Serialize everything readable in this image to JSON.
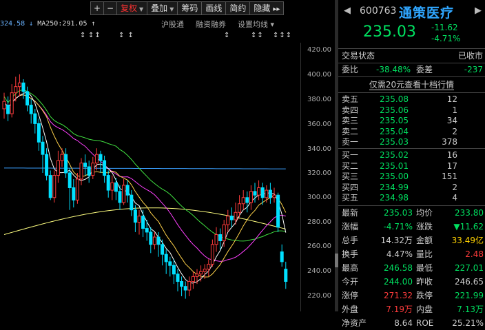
{
  "toolbar": {
    "items": [
      {
        "label": "+",
        "active": false,
        "caret": false
      },
      {
        "label": "−",
        "active": false,
        "caret": false
      },
      {
        "label": "复权",
        "active": true,
        "caret": true
      },
      {
        "label": "叠加",
        "active": false,
        "caret": true
      },
      {
        "label": "筹码",
        "active": false,
        "caret": false
      },
      {
        "label": "画线",
        "active": false,
        "caret": false
      },
      {
        "label": "简约",
        "active": false,
        "caret": false
      },
      {
        "label": "隐藏",
        "active": false,
        "caret": false
      }
    ],
    "more_icon": "double-chevron-right-icon"
  },
  "ma_bar": {
    "ma_prev_value": "324.58",
    "arrow1": "↓",
    "ma250_label": "MA250:",
    "ma250_value": "291.05",
    "arrow2": "↑"
  },
  "subtabs": [
    "沪股通",
    "融资融券",
    "设置均线 ▾"
  ],
  "stars": [
    "↕",
    "↕↕",
    "↕ ↕",
    "↕",
    "↕↕",
    "↕↕↕"
  ],
  "price_axis": [
    "420.00",
    "400.00",
    "380.00",
    "360.00",
    "340.00",
    "320.00",
    "300.00",
    "280.00",
    "260.00",
    "240.00",
    "220.00"
  ],
  "chart_data": {
    "type": "candlestick",
    "y_axis": [
      220,
      420
    ],
    "candles": [
      [
        372,
        378,
        364,
        385
      ],
      [
        375,
        368,
        362,
        382
      ],
      [
        368,
        385,
        365,
        392
      ],
      [
        385,
        390,
        378,
        398
      ],
      [
        390,
        393,
        382,
        400
      ],
      [
        393,
        386,
        380,
        396
      ],
      [
        386,
        375,
        370,
        390
      ],
      [
        375,
        368,
        360,
        380
      ],
      [
        368,
        360,
        352,
        372
      ],
      [
        360,
        345,
        338,
        364
      ],
      [
        345,
        335,
        320,
        350
      ],
      [
        335,
        318,
        314,
        340
      ],
      [
        318,
        300,
        298,
        322
      ],
      [
        300,
        318,
        296,
        322
      ],
      [
        318,
        330,
        312,
        338
      ],
      [
        330,
        335,
        325,
        340
      ],
      [
        335,
        320,
        316,
        340
      ],
      [
        320,
        308,
        290,
        324
      ],
      [
        308,
        298,
        292,
        315
      ],
      [
        298,
        315,
        295,
        320
      ],
      [
        315,
        328,
        310,
        332
      ],
      [
        328,
        325,
        318,
        335
      ],
      [
        325,
        318,
        312,
        330
      ],
      [
        318,
        328,
        315,
        333
      ],
      [
        328,
        335,
        322,
        340
      ],
      [
        335,
        330,
        320,
        338
      ],
      [
        330,
        318,
        312,
        334
      ],
      [
        318,
        306,
        300,
        322
      ],
      [
        306,
        312,
        298,
        318
      ],
      [
        312,
        305,
        298,
        316
      ],
      [
        305,
        296,
        290,
        310
      ],
      [
        296,
        310,
        294,
        315
      ],
      [
        310,
        302,
        296,
        314
      ],
      [
        302,
        290,
        285,
        306
      ],
      [
        290,
        280,
        272,
        294
      ],
      [
        280,
        285,
        270,
        290
      ],
      [
        285,
        275,
        268,
        290
      ],
      [
        275,
        272,
        265,
        282
      ],
      [
        272,
        262,
        255,
        276
      ],
      [
        262,
        268,
        258,
        272
      ],
      [
        268,
        262,
        252,
        272
      ],
      [
        262,
        254,
        245,
        266
      ],
      [
        254,
        248,
        238,
        258
      ],
      [
        248,
        245,
        236,
        252
      ],
      [
        245,
        238,
        230,
        250
      ],
      [
        238,
        232,
        224,
        242
      ],
      [
        232,
        228,
        220,
        236
      ],
      [
        228,
        225,
        218,
        232
      ],
      [
        225,
        232,
        220,
        236
      ],
      [
        232,
        236,
        226,
        240
      ],
      [
        236,
        238,
        230,
        242
      ],
      [
        238,
        240,
        232,
        245
      ],
      [
        240,
        242,
        234,
        246
      ],
      [
        242,
        246,
        236,
        250
      ],
      [
        246,
        262,
        244,
        266
      ],
      [
        262,
        270,
        256,
        276
      ],
      [
        270,
        265,
        258,
        275
      ],
      [
        265,
        278,
        260,
        282
      ],
      [
        278,
        285,
        272,
        290
      ],
      [
        285,
        282,
        276,
        292
      ],
      [
        282,
        288,
        278,
        296
      ],
      [
        288,
        295,
        284,
        302
      ],
      [
        295,
        300,
        290,
        306
      ],
      [
        300,
        296,
        288,
        305
      ],
      [
        296,
        305,
        290,
        310
      ],
      [
        305,
        302,
        296,
        312
      ],
      [
        302,
        308,
        298,
        314
      ],
      [
        308,
        300,
        294,
        312
      ],
      [
        300,
        306,
        296,
        310
      ],
      [
        306,
        300,
        295,
        312
      ],
      [
        300,
        302,
        296,
        308
      ],
      [
        302,
        276,
        272,
        304
      ],
      [
        256,
        248,
        244,
        262
      ],
      [
        242,
        232,
        226,
        248
      ]
    ],
    "series_colors": {
      "ma5": "#ffffff",
      "ma10": "#ffd24a",
      "ma20": "#ff40ff",
      "ma60": "#40e040",
      "ma120": "#dcdcdc",
      "ma250": "#ffff80",
      "ma_prev": "#3aa0ff"
    }
  },
  "quote": {
    "code": "600763",
    "name": "通策医疗",
    "price": "235.03",
    "change": "-11.62",
    "change_pct": "-4.71%",
    "status_label": "交易状态",
    "status_value": "已收市",
    "weibi_label": "委比",
    "weibi_value": "-38.48%",
    "weicha_label": "委差",
    "weicha_value": "-237",
    "level10_link": "仅需20元查看十档行情",
    "asks": [
      {
        "label": "卖五",
        "price": "235.08",
        "vol": "12"
      },
      {
        "label": "卖四",
        "price": "235.06",
        "vol": "1"
      },
      {
        "label": "卖三",
        "price": "235.05",
        "vol": "34"
      },
      {
        "label": "卖二",
        "price": "235.04",
        "vol": "2"
      },
      {
        "label": "卖一",
        "price": "235.03",
        "vol": "378"
      }
    ],
    "bids": [
      {
        "label": "买一",
        "price": "235.02",
        "vol": "16"
      },
      {
        "label": "买二",
        "price": "235.01",
        "vol": "17"
      },
      {
        "label": "买三",
        "price": "235.00",
        "vol": "151"
      },
      {
        "label": "买四",
        "price": "234.99",
        "vol": "2"
      },
      {
        "label": "买五",
        "price": "234.98",
        "vol": "4"
      }
    ],
    "stats": [
      {
        "l1": "最新",
        "v1": "235.03",
        "c1": "green",
        "l2": "均价",
        "v2": "233.80",
        "c2": "green"
      },
      {
        "l1": "涨幅",
        "v1": "-4.71%",
        "c1": "green",
        "l2": "涨跌",
        "v2": "▼11.62",
        "c2": "green"
      },
      {
        "l1": "总手",
        "v1": "14.32万",
        "c1": "",
        "l2": "金额",
        "v2": "33.49亿",
        "c2": "yellow"
      },
      {
        "l1": "换手",
        "v1": "4.47%",
        "c1": "",
        "l2": "量比",
        "v2": "2.48",
        "c2": "red"
      },
      {
        "l1": "最高",
        "v1": "246.58",
        "c1": "green",
        "l2": "最低",
        "v2": "227.01",
        "c2": "green"
      },
      {
        "l1": "今开",
        "v1": "244.00",
        "c1": "green",
        "l2": "昨收",
        "v2": "246.65",
        "c2": ""
      },
      {
        "l1": "涨停",
        "v1": "271.32",
        "c1": "red",
        "l2": "跌停",
        "v2": "221.99",
        "c2": "green"
      },
      {
        "l1": "外盘",
        "v1": "7.19万",
        "c1": "red",
        "l2": "内盘",
        "v2": "7.13万",
        "c2": "green"
      },
      {
        "l1": "净资产",
        "v1": "8.64",
        "c1": "",
        "l2": "ROE",
        "v2": "25.21%",
        "c2": ""
      }
    ]
  }
}
